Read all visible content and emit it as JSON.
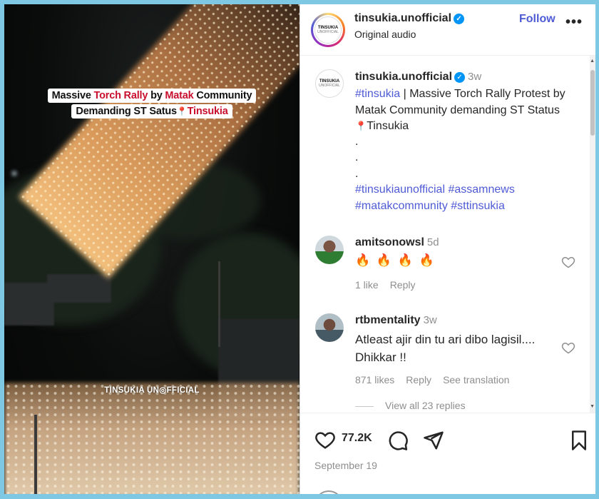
{
  "video": {
    "caption_line1_a": "Massive ",
    "caption_line1_b": "Torch Rally",
    "caption_line1_c": " by ",
    "caption_line1_d": "Matak",
    "caption_line1_e": " Community",
    "caption_line2_a": "Demanding ST Satus",
    "caption_line2_pin": "📍",
    "caption_line2_b": "Tinsukia",
    "watermark": "TINSUKIA UN◎FFICIAL"
  },
  "header": {
    "logo_line1": "TINSUKIA",
    "logo_line2": "UNOFFICIAL",
    "username": "tinsukia.unofficial",
    "verified_icon": "✓",
    "audio": "Original audio",
    "follow_label": "Follow",
    "more_label": "•••"
  },
  "post": {
    "username": "tinsukia.unofficial",
    "time": "3w",
    "hashtag1": "#tinsukia",
    "text": " | Massive Torch Rally Protest by Matak Community demanding ST Status",
    "pin": "📍",
    "place": "Tinsukia",
    "dot1": ".",
    "dot2": ".",
    "dot3": ".",
    "tag_line1": "#tinsukiaunofficial #assamnews",
    "tag_line2": "#matakcommunity #sttinsukia"
  },
  "comments": [
    {
      "username": "amitsonowsl",
      "time": "5d",
      "text": "🔥 🔥 🔥 🔥",
      "likes": "1 like",
      "reply": "Reply"
    },
    {
      "username": "rtbmentality",
      "time": "3w",
      "text": "Atleast ajir din tu ari dibo lagisil.... Dhikkar !!",
      "likes": "871 likes",
      "reply": "Reply",
      "translate": "See translation",
      "view_replies": "View all 23 replies"
    }
  ],
  "actions": {
    "like_count": "77.2K",
    "date": "September 19"
  },
  "colors": {
    "link": "#4f5bd5",
    "caption_red": "#c8102e",
    "verified": "#0095f6"
  }
}
